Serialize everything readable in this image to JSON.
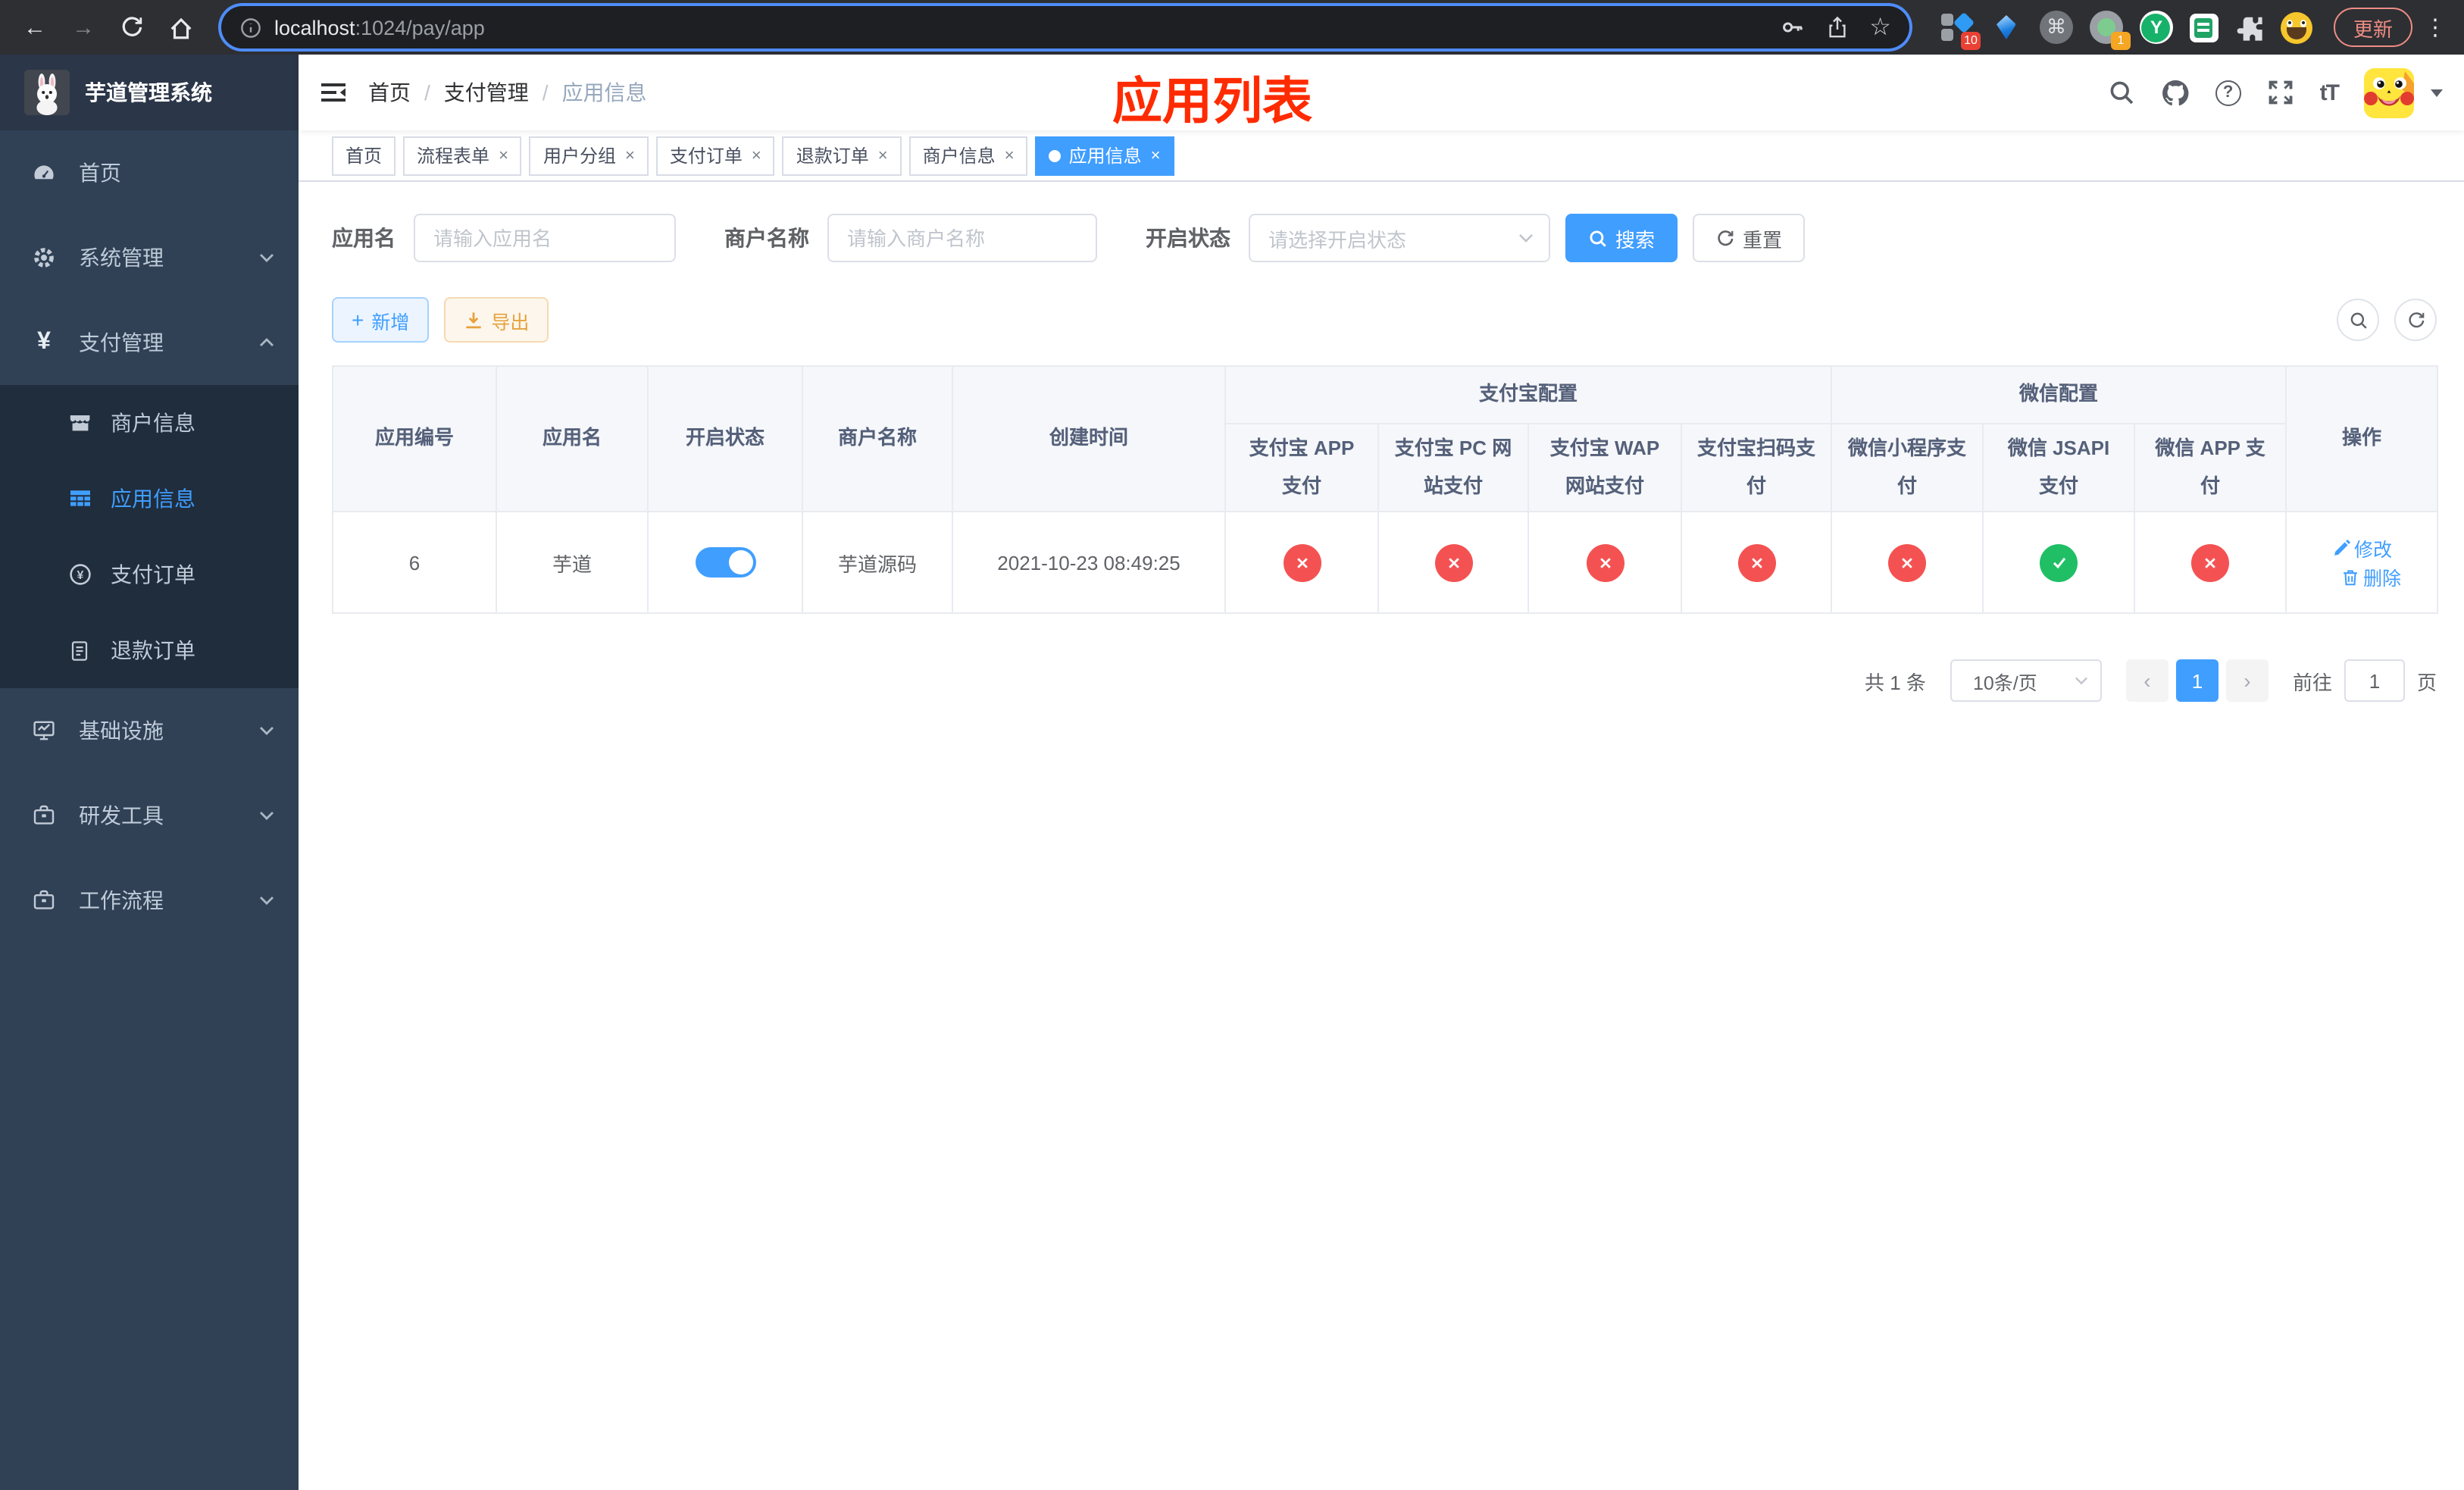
{
  "browser": {
    "url": {
      "host": "localhost",
      "path": ":1024/pay/app"
    },
    "update_label": "更新",
    "extension_badge_1": "10",
    "extension_badge_2": "1",
    "extension_y_label": "Y"
  },
  "icons": {
    "back": "←",
    "forward": "→",
    "star": "☆",
    "command": "⌘",
    "kebab": "⋮",
    "question": "?",
    "fontsize": "tT",
    "yen": "¥",
    "plus": "+",
    "close": "×",
    "prev": "‹",
    "next": "›"
  },
  "annotation": {
    "title": "应用列表",
    "color": "#ff2b00"
  },
  "sidebar": {
    "title": "芋道管理系统",
    "home": "首页",
    "system": "系统管理",
    "payment": "支付管理",
    "sub_merchant": "商户信息",
    "sub_app": "应用信息",
    "sub_order": "支付订单",
    "sub_refund": "退款订单",
    "infra": "基础设施",
    "devtools": "研发工具",
    "workflow": "工作流程"
  },
  "breadcrumb": {
    "items": [
      "首页",
      "支付管理",
      "应用信息"
    ],
    "separator": "/"
  },
  "tabs": [
    "首页",
    "流程表单",
    "用户分组",
    "支付订单",
    "退款订单",
    "商户信息",
    "应用信息"
  ],
  "search": {
    "app_name_label": "应用名",
    "app_name_placeholder": "请输入应用名",
    "merchant_label": "商户名称",
    "merchant_placeholder": "请输入商户名称",
    "status_label": "开启状态",
    "status_placeholder": "请选择开启状态",
    "search_label": "搜索",
    "reset_label": "重置"
  },
  "toolbar": {
    "add_label": "新增",
    "export_label": "导出"
  },
  "table": {
    "columns": [
      "应用编号",
      "应用名",
      "开启状态",
      "商户名称",
      "创建时间"
    ],
    "group_alipay": "支付宝配置",
    "group_wechat": "微信配置",
    "alipay_cols": [
      "支付宝 APP 支付",
      "支付宝 PC 网站支付",
      "支付宝 WAP 网站支付",
      "支付宝扫码支付"
    ],
    "wechat_cols": [
      "微信小程序支付",
      "微信 JSAPI 支付",
      "微信 APP 支付"
    ],
    "ops_col": "操作",
    "row": {
      "id": "6",
      "name": "芋道",
      "enabled": true,
      "merchant": "芋道源码",
      "created": "2021-10-23 08:49:25",
      "pay_status": [
        "disabled",
        "disabled",
        "disabled",
        "disabled",
        "disabled",
        "enabled",
        "disabled"
      ],
      "edit_label": "修改",
      "delete_label": "删除"
    }
  },
  "pagination": {
    "total": "共 1 条",
    "page_size": "10条/页",
    "current_page": "1",
    "goto_label": "前往",
    "goto_value": "1",
    "unit_label": "页"
  },
  "colors": {
    "accent": "#409eff",
    "success": "#20bf66",
    "danger": "#f45252",
    "sidebar": "#304156",
    "submenu": "#1f2d3d"
  }
}
